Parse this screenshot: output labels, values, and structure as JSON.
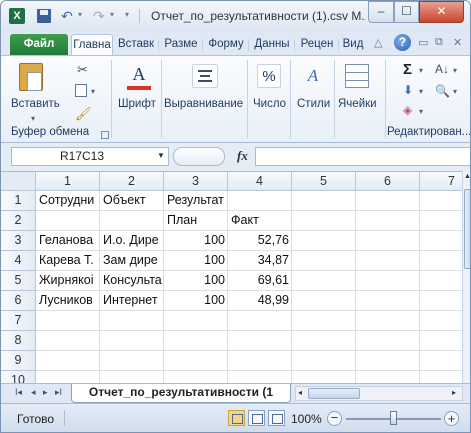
{
  "window": {
    "title": "Отчет_по_результативности (1).csv M...",
    "minimize_label": "–",
    "maximize_label": "☐",
    "close_label": "✕"
  },
  "app_icon_letter": "X",
  "tabs": [
    {
      "label": "Файл"
    },
    {
      "label": "Главна"
    },
    {
      "label": "Вставк"
    },
    {
      "label": "Разме"
    },
    {
      "label": "Форму"
    },
    {
      "label": "Данны"
    },
    {
      "label": "Рецен"
    },
    {
      "label": "Вид"
    }
  ],
  "help_label": "?",
  "ribbon": {
    "paste_label": "Вставить",
    "clipboard_group": "Буфер обмена",
    "font_label": "Шрифт",
    "align_label": "Выравнивание",
    "number_label": "Число",
    "styles_label": "Стили",
    "cells_label": "Ячейки",
    "editing_group": "Редактирован...",
    "number_symbol": "%",
    "font_symbol": "A",
    "styles_symbol": "A",
    "sum_symbol": "Σ"
  },
  "formula_bar": {
    "name_box": "R17C13",
    "fx_label": "fx",
    "formula": ""
  },
  "grid": {
    "columns": [
      "1",
      "2",
      "3",
      "4",
      "5",
      "6",
      "7"
    ],
    "rows": [
      "1",
      "2",
      "3",
      "4",
      "5",
      "6",
      "7",
      "8",
      "9",
      "10"
    ],
    "cells": {
      "r1c1": "Сотрудни",
      "r1c2": "Объект",
      "r1c3": "Результат",
      "r2c3": "План",
      "r2c4": "Факт",
      "r3c1": "Геланова",
      "r3c2": "И.о. Дире",
      "r3c3": "100",
      "r3c4": "52,76",
      "r4c1": "Карева Т.",
      "r4c2": "Зам дире",
      "r4c3": "100",
      "r4c4": "34,87",
      "r5c1": "Жирнякоі",
      "r5c2": "Консульта",
      "r5c3": "100",
      "r5c4": "69,61",
      "r6c1": "Лусников",
      "r6c2": "Интернет",
      "r6c3": "100",
      "r6c4": "48,99"
    }
  },
  "sheet": {
    "nav_buttons": [
      "I◂",
      "◂",
      "▸",
      "▸I"
    ],
    "active_tab": "Отчет_по_результативности (1"
  },
  "status": {
    "ready": "Готово",
    "zoom": "100%",
    "zoom_minus": "−",
    "zoom_plus": "+"
  }
}
